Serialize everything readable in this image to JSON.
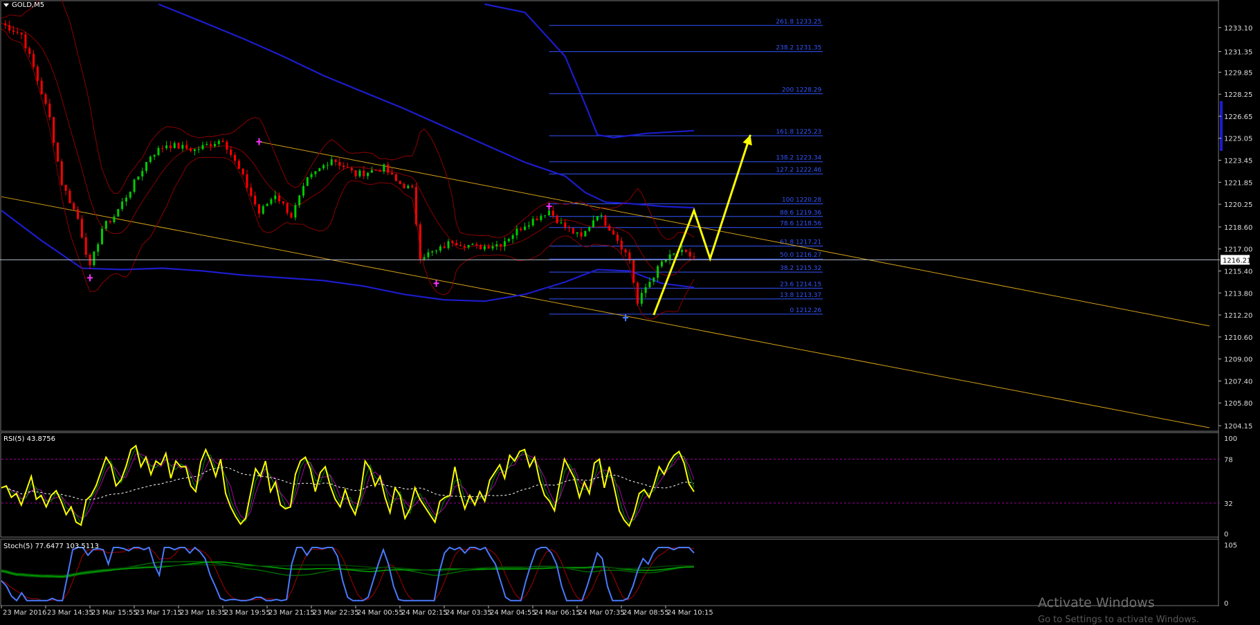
{
  "main_title": "GOLD,M5",
  "colors": {
    "background": "#000000",
    "candle_up": "#00cc00",
    "candle_down": "#ff0000",
    "fib": "#3355ff",
    "channel": "#d4a017",
    "ma": "#1c1ccc",
    "bands": "#8b0000",
    "arrow": "#ffff00",
    "rsi": "#ffff00",
    "stoch": "#4a7bff"
  },
  "chart_data": [
    {
      "type": "candlestick",
      "symbol": "GOLD",
      "timeframe": "M5",
      "current_price": "1216.21",
      "y_ticks": [
        "1233.10",
        "1231.35",
        "1229.85",
        "1228.25",
        "1226.65",
        "1225.05",
        "1223.45",
        "1221.85",
        "1220.25",
        "1218.60",
        "1217.00",
        "1215.40",
        "1213.80",
        "1212.20",
        "1210.60",
        "1209.00",
        "1207.40",
        "1205.80",
        "1204.15"
      ],
      "ylim": [
        1203.9,
        1234.7
      ],
      "x_ticks": [
        "23 Mar 2016",
        "23 Mar 14:35",
        "23 Mar 15:55",
        "23 Mar 17:15",
        "23 Mar 18:35",
        "23 Mar 19:55",
        "23 Mar 21:15",
        "23 Mar 22:35",
        "24 Mar 00:55",
        "24 Mar 02:15",
        "24 Mar 03:35",
        "24 Mar 04:55",
        "24 Mar 06:15",
        "24 Mar 07:35",
        "24 Mar 08:55",
        "24 Mar 10:15"
      ],
      "close_path": [
        [
          0,
          1233.4
        ],
        [
          5,
          1232.6
        ],
        [
          8,
          1230.2
        ],
        [
          12,
          1226.5
        ],
        [
          15,
          1221.8
        ],
        [
          19,
          1219.2
        ],
        [
          22,
          1215.6
        ],
        [
          25,
          1218.5
        ],
        [
          28,
          1219.4
        ],
        [
          33,
          1221.8
        ],
        [
          37,
          1223.8
        ],
        [
          41,
          1224.6
        ],
        [
          48,
          1224.2
        ],
        [
          55,
          1225.0
        ],
        [
          60,
          1222.2
        ],
        [
          64,
          1219.6
        ],
        [
          68,
          1221.0
        ],
        [
          72,
          1219.4
        ],
        [
          76,
          1222.0
        ],
        [
          82,
          1223.6
        ],
        [
          88,
          1222.4
        ],
        [
          95,
          1222.9
        ],
        [
          98,
          1221.9
        ],
        [
          102,
          1221.3
        ],
        [
          104,
          1216.5
        ],
        [
          108,
          1216.8
        ],
        [
          112,
          1217.6
        ],
        [
          118,
          1217.1
        ],
        [
          124,
          1217.4
        ],
        [
          130,
          1218.8
        ],
        [
          136,
          1219.8
        ],
        [
          139,
          1218.8
        ],
        [
          144,
          1217.8
        ],
        [
          148,
          1219.6
        ],
        [
          152,
          1218.2
        ],
        [
          156,
          1216.2
        ],
        [
          158,
          1213.0
        ],
        [
          160,
          1214.2
        ],
        [
          164,
          1216.0
        ],
        [
          168,
          1216.8
        ],
        [
          172,
          1216.4
        ]
      ],
      "moving_average": [
        [
          0,
          1219.8
        ],
        [
          10,
          1217.6
        ],
        [
          20,
          1215.6
        ],
        [
          30,
          1215.5
        ],
        [
          40,
          1215.6
        ],
        [
          50,
          1215.4
        ],
        [
          60,
          1215.1
        ],
        [
          70,
          1214.9
        ],
        [
          80,
          1214.7
        ],
        [
          90,
          1214.3
        ],
        [
          100,
          1213.7
        ],
        [
          110,
          1213.3
        ],
        [
          120,
          1213.2
        ],
        [
          130,
          1213.7
        ],
        [
          140,
          1214.6
        ],
        [
          148,
          1215.5
        ],
        [
          156,
          1215.4
        ],
        [
          164,
          1214.5
        ],
        [
          172,
          1214.2
        ]
      ],
      "ma_top": [
        [
          39,
          1234.8
        ],
        [
          50,
          1233.5
        ],
        [
          60,
          1232.3
        ],
        [
          70,
          1231.0
        ],
        [
          80,
          1229.6
        ],
        [
          90,
          1228.4
        ],
        [
          100,
          1227.2
        ],
        [
          110,
          1225.9
        ],
        [
          120,
          1224.6
        ],
        [
          130,
          1223.3
        ],
        [
          140,
          1222.3
        ],
        [
          145,
          1221.1
        ],
        [
          150,
          1220.4
        ],
        [
          156,
          1220.3
        ],
        [
          164,
          1220.1
        ],
        [
          172,
          1220.0
        ]
      ],
      "ma_upper": [
        [
          120,
          1234.8
        ],
        [
          130,
          1234.2
        ],
        [
          140,
          1231.0
        ],
        [
          145,
          1227.5
        ],
        [
          148,
          1225.3
        ],
        [
          152,
          1225.1
        ],
        [
          160,
          1225.4
        ],
        [
          172,
          1225.6
        ]
      ],
      "swing_markers": [
        [
          22,
          1214.9,
          "high"
        ],
        [
          64,
          1224.8,
          "low"
        ],
        [
          108,
          1214.5,
          "high"
        ],
        [
          136,
          1220.1,
          "low"
        ],
        [
          155,
          1212.0,
          "high"
        ]
      ],
      "fibonacci": [
        {
          "label": "261.8 1233.25",
          "price": 1233.25
        },
        {
          "label": "238.2 1231.35",
          "price": 1231.35
        },
        {
          "label": "200 1228.29",
          "price": 1228.29
        },
        {
          "label": "161.8 1225.23",
          "price": 1225.23
        },
        {
          "label": "138.2 1223.34",
          "price": 1223.34
        },
        {
          "label": "127.2 1222.46",
          "price": 1222.46
        },
        {
          "label": "100 1220.28",
          "price": 1220.28
        },
        {
          "label": "88.6 1219.36",
          "price": 1219.36
        },
        {
          "label": "78.6 1218.56",
          "price": 1218.56
        },
        {
          "label": "61.8 1217.21",
          "price": 1217.21
        },
        {
          "label": "50.0 1216.27",
          "price": 1216.27
        },
        {
          "label": "38.2 1215.32",
          "price": 1215.32
        },
        {
          "label": "23.6 1214.15",
          "price": 1214.15
        },
        {
          "label": "13.8 1213.37",
          "price": 1213.37
        },
        {
          "label": "0 1212.26",
          "price": 1212.26
        }
      ],
      "fib_range": [
        136,
        204
      ],
      "channel_upper": [
        [
          64,
          1224.8
        ],
        [
          300,
          1211.4
        ]
      ],
      "channel_lower": [
        [
          0,
          1220.8
        ],
        [
          300,
          1204.0
        ]
      ],
      "projection_arrow": [
        [
          162,
          1212.2
        ],
        [
          172,
          1219.8
        ],
        [
          176,
          1216.3
        ],
        [
          186,
          1225.3
        ]
      ]
    },
    {
      "type": "line",
      "title": "RSI(5) 43.8756",
      "y_ticks": [
        "100",
        "78",
        "32",
        "0"
      ],
      "ylim": [
        0,
        100
      ],
      "levels": [
        78,
        32
      ],
      "series": [
        {
          "name": "RSI(5)",
          "values": [
            48,
            50,
            38,
            42,
            30,
            45,
            60,
            36,
            40,
            28,
            40,
            45,
            34,
            20,
            28,
            12,
            9,
            35,
            40,
            50,
            65,
            80,
            72,
            50,
            56,
            70,
            88,
            92,
            70,
            80,
            62,
            76,
            72,
            84,
            58,
            76,
            70,
            70,
            50,
            44,
            75,
            88,
            76,
            60,
            78,
            42,
            28,
            18,
            10,
            16,
            42,
            68,
            60,
            76,
            44,
            54,
            30,
            26,
            28,
            62,
            76,
            80,
            68,
            44,
            64,
            70,
            50,
            36,
            28,
            46,
            30,
            20,
            40,
            76,
            68,
            50,
            60,
            38,
            22,
            48,
            40,
            16,
            26,
            48,
            36,
            28,
            20,
            12,
            34,
            38,
            40,
            70,
            44,
            26,
            40,
            30,
            44,
            34,
            56,
            64,
            72,
            58,
            82,
            76,
            86,
            88,
            70,
            80,
            56,
            40,
            34,
            24,
            52,
            78,
            68,
            58,
            38,
            54,
            42,
            74,
            78,
            48,
            70,
            48,
            24,
            14,
            8,
            22,
            42,
            46,
            38,
            52,
            70,
            62,
            74,
            82,
            86,
            74,
            52,
            43.9
          ]
        }
      ]
    },
    {
      "type": "line",
      "title": "Stoch(5) 77.6477 103.5113",
      "y_ticks": [
        "105",
        "0"
      ],
      "ylim": [
        0,
        105
      ],
      "series": [
        {
          "name": "%K",
          "values": [
            40,
            30,
            12,
            4,
            18,
            4,
            4,
            4,
            4,
            4,
            8,
            4,
            4,
            50,
            96,
            100,
            100,
            86,
            96,
            98,
            96,
            70,
            100,
            100,
            98,
            94,
            100,
            100,
            96,
            100,
            70,
            50,
            100,
            100,
            96,
            100,
            100,
            90,
            100,
            92,
            80,
            50,
            30,
            8,
            4,
            6,
            6,
            4,
            4,
            6,
            10,
            10,
            4,
            4,
            6,
            4,
            6,
            70,
            100,
            100,
            86,
            100,
            100,
            98,
            100,
            100,
            84,
            40,
            10,
            4,
            4,
            4,
            10,
            40,
            70,
            96,
            70,
            30,
            6,
            4,
            4,
            4,
            4,
            4,
            4,
            4,
            56,
            90,
            100,
            96,
            100,
            90,
            100,
            100,
            96,
            100,
            84,
            70,
            40,
            10,
            4,
            4,
            4,
            40,
            70,
            96,
            100,
            100,
            90,
            70,
            30,
            4,
            4,
            4,
            4,
            30,
            60,
            90,
            80,
            30,
            4,
            4,
            4,
            8,
            30,
            60,
            80,
            70,
            90,
            100,
            100,
            100,
            96,
            100,
            100,
            100,
            90
          ]
        }
      ]
    }
  ],
  "watermark": {
    "line1": "Activate Windows",
    "line2": "Go to Settings to activate Windows."
  }
}
